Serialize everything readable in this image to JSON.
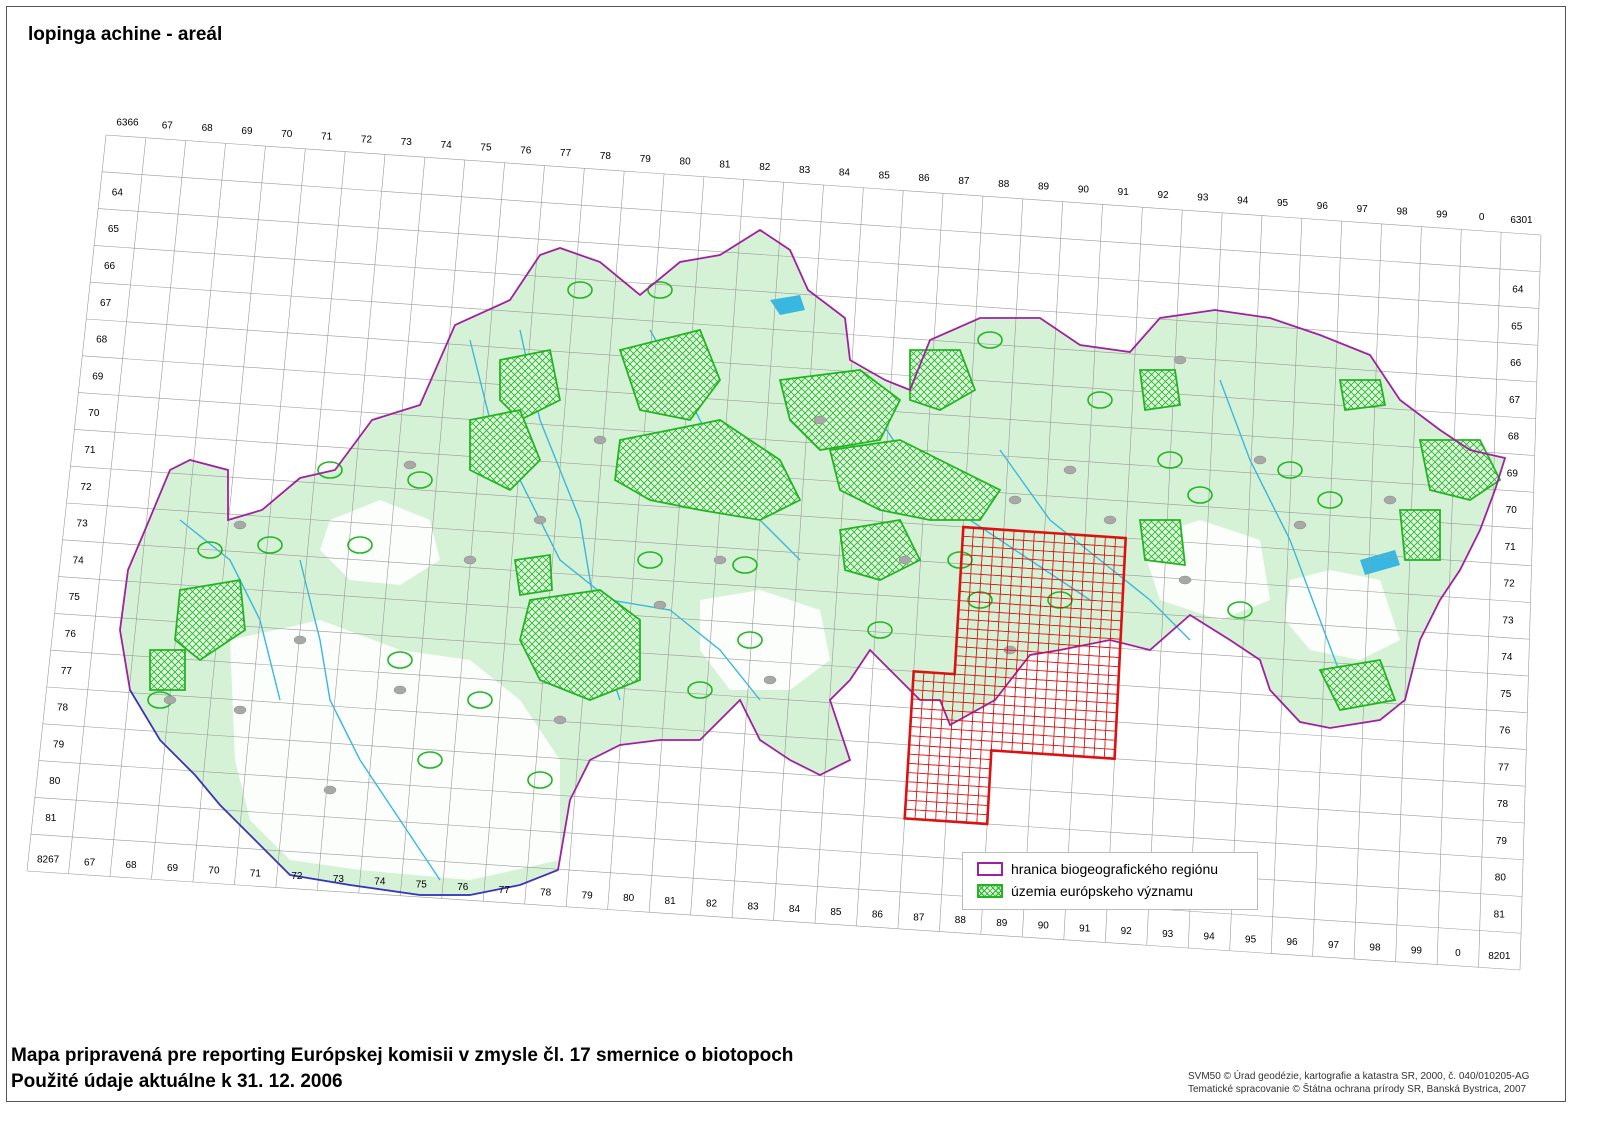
{
  "title": "lopinga achine - areál",
  "footer": {
    "line1": "Mapa pripravená pre reporting Európskej komisii v zmysle čl. 17 smernice o biotopoch",
    "line2": "Použité údaje aktuálne k 31. 12. 2006"
  },
  "credits": {
    "line1": "SVM50 © Úrad geodézie, kartografie a katastra SR, 2000, č. 040/010205-AG",
    "line2": "Tematické spracovanie © Štátna ochrana prírody SR, Banská Bystrica, 2007"
  },
  "legend": {
    "border_label": "hranica biogeografického regiónu",
    "sites_label": "územia európskeho významu"
  },
  "grid": {
    "top_labels": [
      "6366",
      "67",
      "68",
      "69",
      "70",
      "71",
      "72",
      "73",
      "74",
      "75",
      "76",
      "77",
      "78",
      "79",
      "80",
      "81",
      "82",
      "83",
      "84",
      "85",
      "86",
      "87",
      "88",
      "89",
      "90",
      "91",
      "92",
      "93",
      "94",
      "95",
      "96",
      "97",
      "98",
      "99",
      "0",
      "6301"
    ],
    "bottom_labels": [
      "8267",
      "67",
      "68",
      "69",
      "70",
      "71",
      "72",
      "73",
      "74",
      "75",
      "76",
      "77",
      "78",
      "79",
      "80",
      "81",
      "82",
      "83",
      "84",
      "85",
      "86",
      "87",
      "88",
      "89",
      "90",
      "91",
      "92",
      "93",
      "94",
      "95",
      "96",
      "97",
      "98",
      "99",
      "0",
      "8201"
    ],
    "left_labels": [
      "64",
      "65",
      "66",
      "67",
      "68",
      "69",
      "70",
      "71",
      "72",
      "73",
      "74",
      "75",
      "76",
      "77",
      "78",
      "79",
      "80",
      "81"
    ],
    "right_labels": [
      "64",
      "65",
      "66",
      "67",
      "68",
      "69",
      "70",
      "71",
      "72",
      "73",
      "74",
      "75",
      "76",
      "77",
      "78",
      "79",
      "80",
      "81"
    ]
  },
  "colors": {
    "border": "#a020a0",
    "sites": "#22b522",
    "fill": "#d6f2d6",
    "rivers": "#38b8e0",
    "range": "#dd1111",
    "grid": "#9a9a9a"
  }
}
